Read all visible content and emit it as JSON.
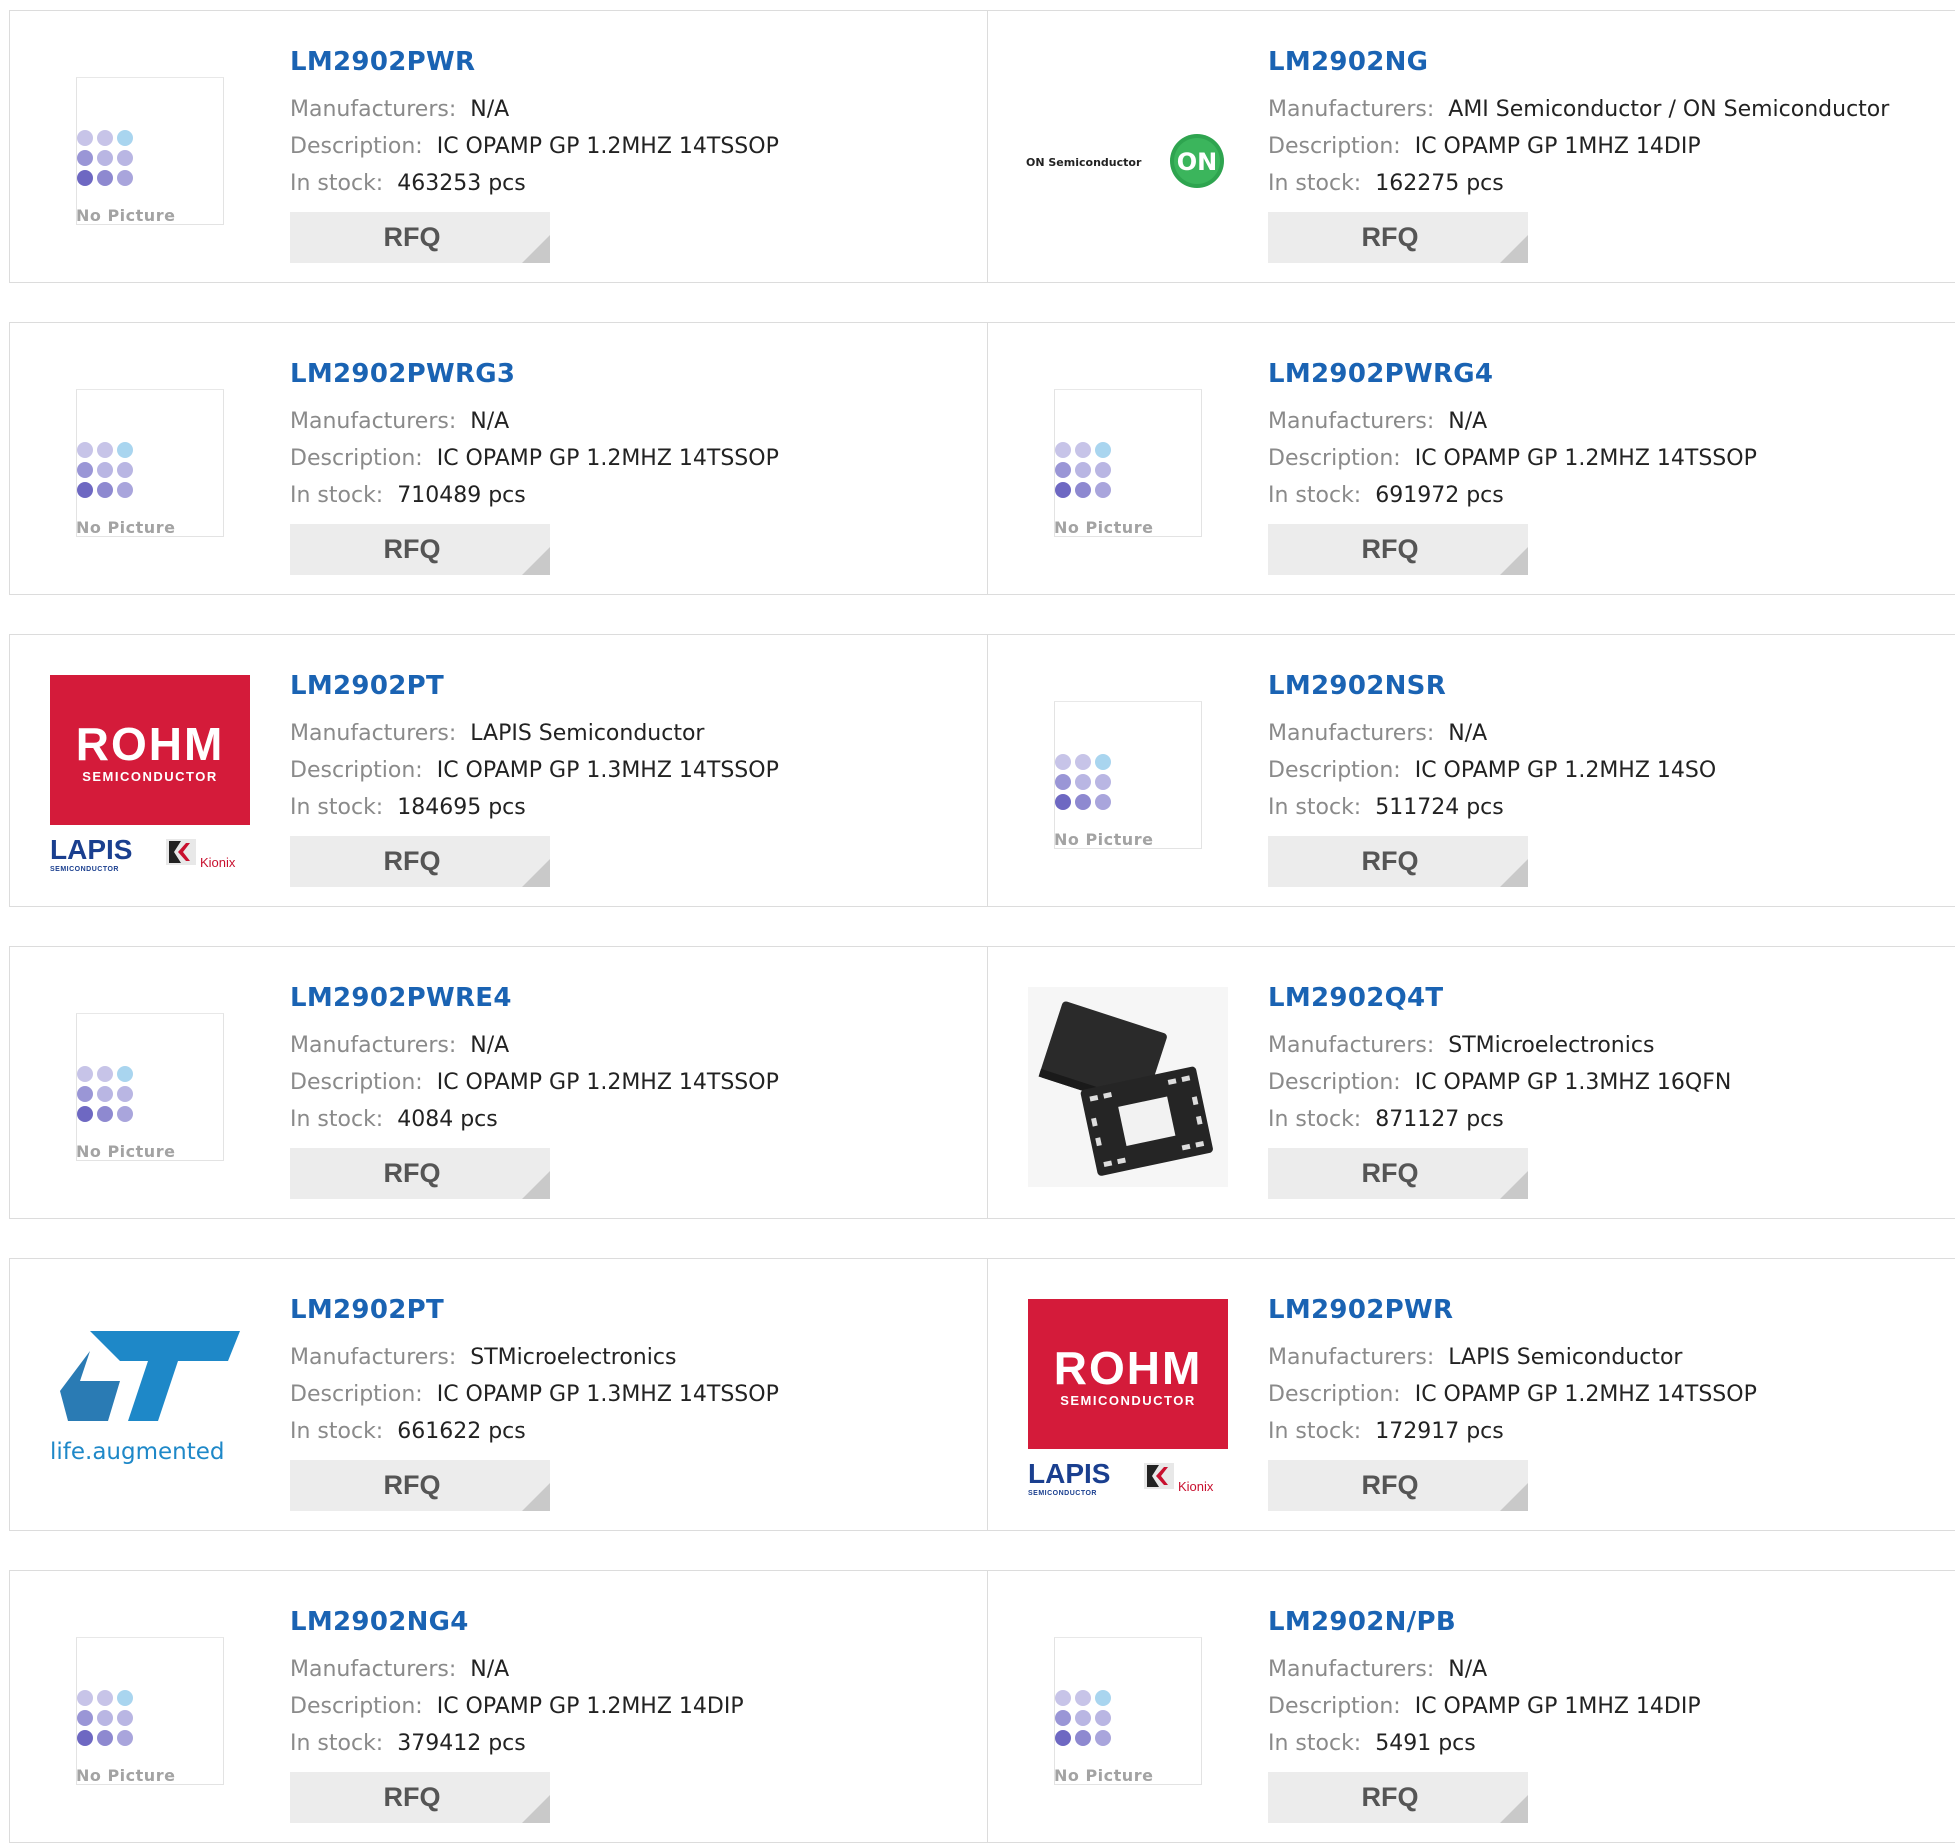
{
  "labels": {
    "manufacturers": "Manufacturers:",
    "description": "Description:",
    "in_stock": "In stock:",
    "rfq": "RFQ",
    "no_picture": "No Picture"
  },
  "logo_text": {
    "on_semi": "ON Semiconductor",
    "on_badge": "ON",
    "rohm": "ROHM",
    "rohm_sub": "SEMICONDUCTOR",
    "lapis": "LAPIS",
    "lapis_sub": "SEMICONDUCTOR",
    "kionix": "Kionix",
    "st_tagline": "life.augmented"
  },
  "products": [
    {
      "part": "LM2902PWR",
      "manufacturer": "N/A",
      "description": "IC OPAMP GP 1.2MHZ 14TSSOP",
      "stock": "463253 pcs",
      "image": "no-picture"
    },
    {
      "part": "LM2902NG",
      "manufacturer": "AMI Semiconductor / ON Semiconductor",
      "description": "IC OPAMP GP 1MHZ 14DIP",
      "stock": "162275 pcs",
      "image": "on-semiconductor-logo"
    },
    {
      "part": "LM2902PWRG3",
      "manufacturer": "N/A",
      "description": "IC OPAMP GP 1.2MHZ 14TSSOP",
      "stock": "710489 pcs",
      "image": "no-picture"
    },
    {
      "part": "LM2902PWRG4",
      "manufacturer": "N/A",
      "description": "IC OPAMP GP 1.2MHZ 14TSSOP",
      "stock": "691972 pcs",
      "image": "no-picture"
    },
    {
      "part": "LM2902PT",
      "manufacturer": "LAPIS Semiconductor",
      "description": "IC OPAMP GP 1.3MHZ 14TSSOP",
      "stock": "184695 pcs",
      "image": "rohm-logo"
    },
    {
      "part": "LM2902NSR",
      "manufacturer": "N/A",
      "description": "IC OPAMP GP 1.2MHZ 14SO",
      "stock": "511724 pcs",
      "image": "no-picture"
    },
    {
      "part": "LM2902PWRE4",
      "manufacturer": "N/A",
      "description": "IC OPAMP GP 1.2MHZ 14TSSOP",
      "stock": "4084 pcs",
      "image": "no-picture"
    },
    {
      "part": "LM2902Q4T",
      "manufacturer": "STMicroelectronics",
      "description": "IC OPAMP GP 1.3MHZ 16QFN",
      "stock": "871127 pcs",
      "image": "qfn-chip-photo"
    },
    {
      "part": "LM2902PT",
      "manufacturer": "STMicroelectronics",
      "description": "IC OPAMP GP 1.3MHZ 14TSSOP",
      "stock": "661622 pcs",
      "image": "st-logo"
    },
    {
      "part": "LM2902PWR",
      "manufacturer": "LAPIS Semiconductor",
      "description": "IC OPAMP GP 1.2MHZ 14TSSOP",
      "stock": "172917 pcs",
      "image": "rohm-logo"
    },
    {
      "part": "LM2902NG4",
      "manufacturer": "N/A",
      "description": "IC OPAMP GP 1.2MHZ 14DIP",
      "stock": "379412 pcs",
      "image": "no-picture"
    },
    {
      "part": "LM2902N/PB",
      "manufacturer": "N/A",
      "description": "IC OPAMP GP 1MHZ 14DIP",
      "stock": "5491 pcs",
      "image": "no-picture"
    }
  ],
  "colors": {
    "part_link": "#1a63b3",
    "label_gray": "#8a8a8a",
    "rfq_bg": "#ececec",
    "rohm_red": "#d41b3a",
    "on_green": "#2ea44f",
    "st_blue": "#1e88c8"
  }
}
